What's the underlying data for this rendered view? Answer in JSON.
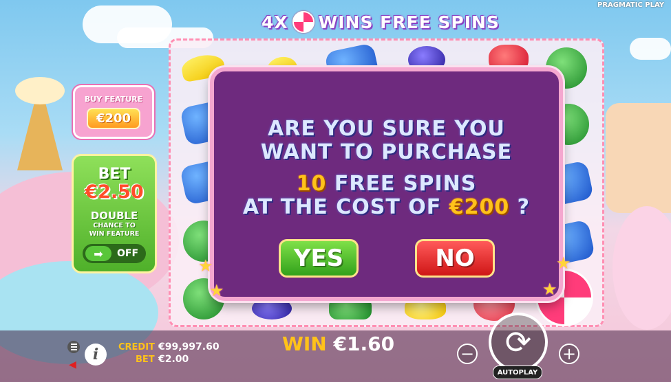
{
  "brand": "PRAGMATIC PLAY",
  "title": {
    "prefix": "4X",
    "suffix": "WINS FREE SPINS"
  },
  "buy_feature": {
    "label": "BUY FEATURE",
    "price": "€200"
  },
  "bet_panel": {
    "title": "BET",
    "amount": "€2.50",
    "double": "DOUBLE",
    "double_sub_1": "CHANCE TO",
    "double_sub_2": "WIN FEATURE",
    "toggle_state": "OFF"
  },
  "modal": {
    "line1": "ARE YOU SURE YOU",
    "line2": "WANT TO PURCHASE",
    "spins_count": "10",
    "spins_text": "FREE SPINS",
    "cost_text": "AT THE COST OF",
    "cost_value": "€200",
    "question_mark": "?",
    "yes_label": "YES",
    "no_label": "NO"
  },
  "footer": {
    "credit_label": "CREDIT",
    "credit_value": "€99,997.60",
    "bet_label": "BET",
    "bet_value": "€2.00",
    "win_label": "WIN",
    "win_value": "€1.60",
    "minus": "−",
    "plus": "+",
    "autoplay_label": "AUTOPLAY"
  },
  "icons": [
    "lollipop-icon",
    "menu-icon",
    "info-icon",
    "sound-icon",
    "arrow-right-icon",
    "spin-icon",
    "star-icon"
  ],
  "colors": {
    "gold": "#ffc21a",
    "modal_bg": "#6e2a7e",
    "yes": "#32a11b",
    "no": "#cf1616"
  }
}
